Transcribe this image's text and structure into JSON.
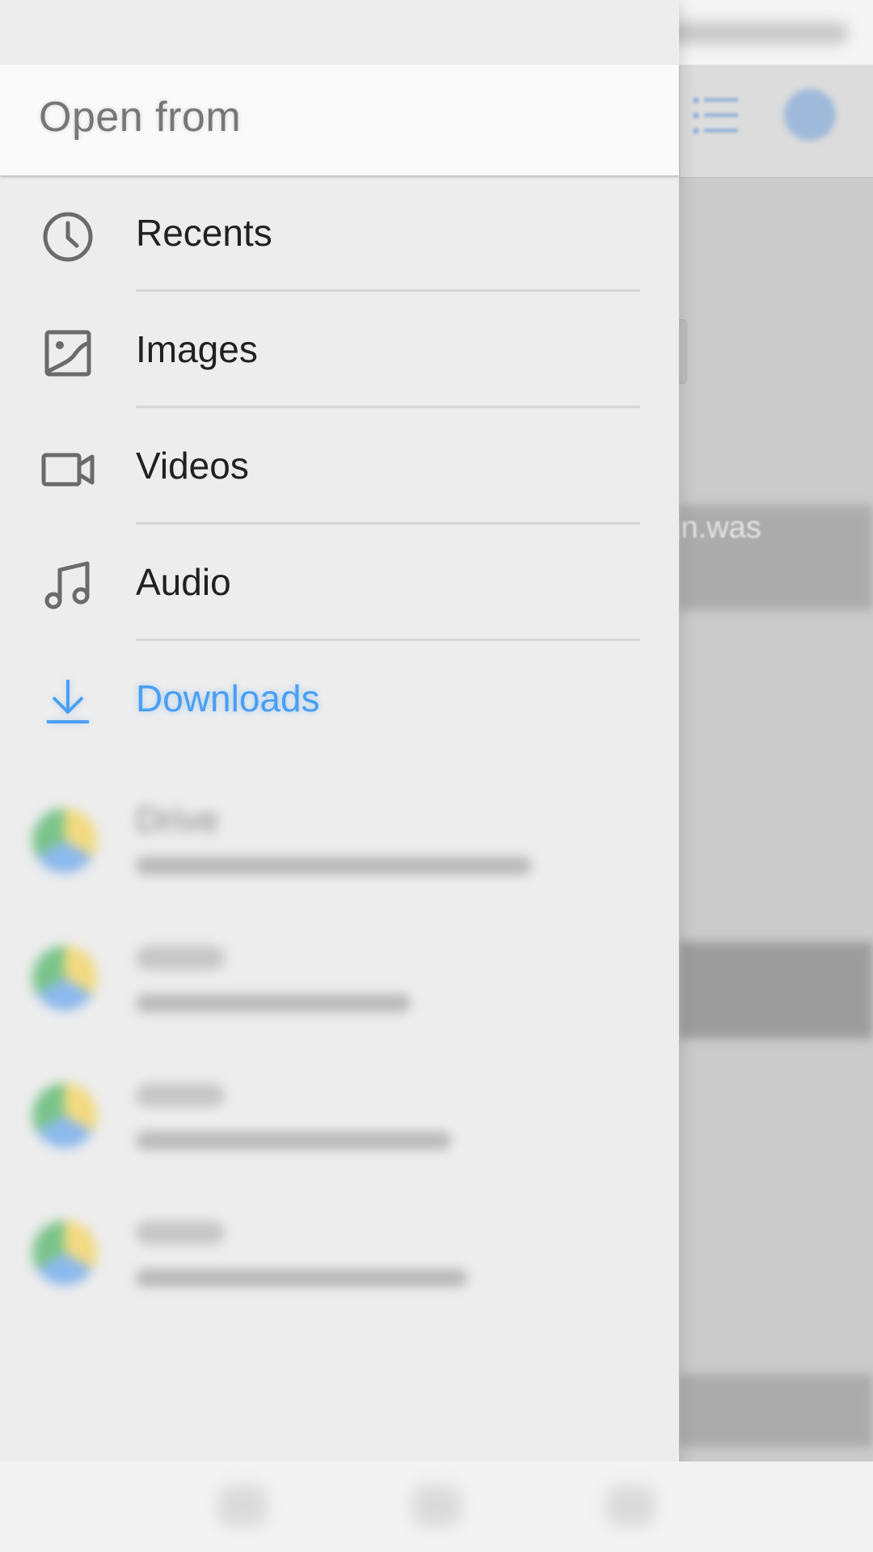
{
  "background_app": {
    "partial_text": "tijn.was"
  },
  "drawer": {
    "title": "Open from",
    "roots": [
      {
        "label": "Recents",
        "icon": "clock-icon",
        "active": false
      },
      {
        "label": "Images",
        "icon": "image-icon",
        "active": false
      },
      {
        "label": "Videos",
        "icon": "videocam-icon",
        "active": false
      },
      {
        "label": "Audio",
        "icon": "music-note-icon",
        "active": false
      },
      {
        "label": "Downloads",
        "icon": "download-icon",
        "active": true
      }
    ],
    "accounts": [
      {
        "label": "Drive",
        "icon": "google-drive-icon"
      },
      {
        "label": "",
        "icon": "google-drive-icon"
      },
      {
        "label": "",
        "icon": "google-drive-icon"
      },
      {
        "label": "",
        "icon": "google-drive-icon"
      }
    ]
  },
  "colors": {
    "accent": "#4a9ff2",
    "text_primary": "#212121",
    "title": "#777777",
    "drawer_bg": "#ededed",
    "header_bg": "#fafafa"
  }
}
